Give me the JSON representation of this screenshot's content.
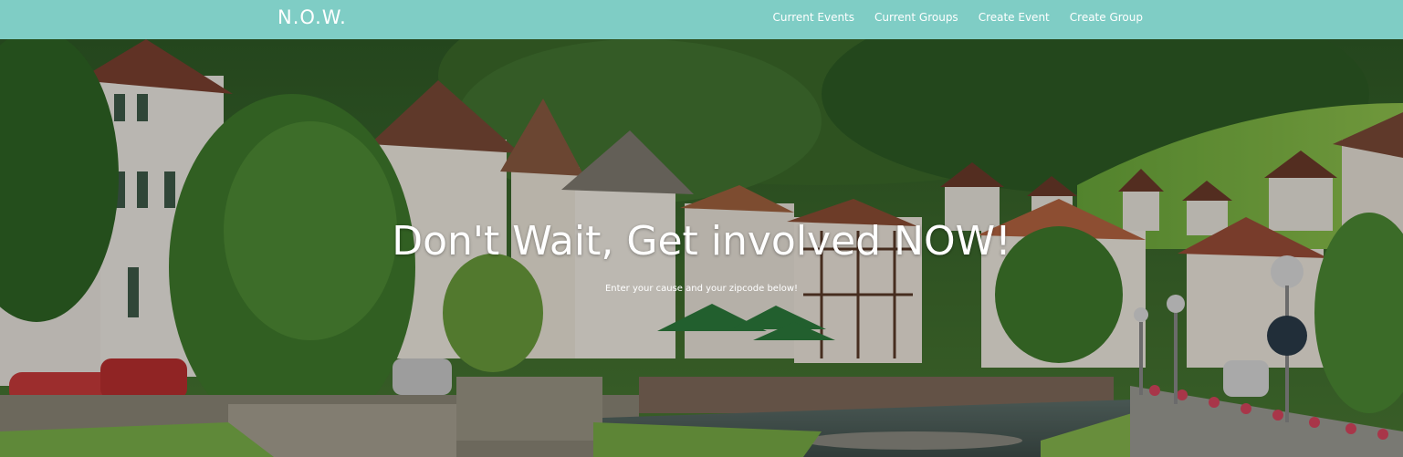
{
  "navbar": {
    "brand": "N.O.W.",
    "background_color": "#7fcdc5",
    "links": [
      {
        "label": "Current Events"
      },
      {
        "label": "Current Groups"
      },
      {
        "label": "Create Event"
      },
      {
        "label": "Create Group"
      }
    ]
  },
  "hero": {
    "headline": "Don't Wait, Get involved NOW!",
    "subheadline": "Enter your cause and your zipcode below!",
    "background_image": "village-street-photo"
  }
}
